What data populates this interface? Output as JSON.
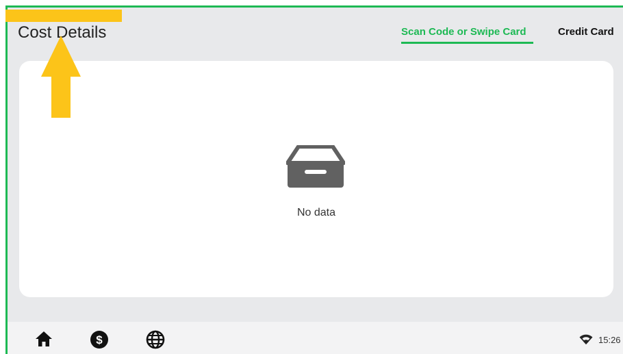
{
  "header": {
    "title": "Cost Details",
    "tabs": [
      {
        "label": "Scan Code or Swipe Card",
        "active": true
      },
      {
        "label": "Credit Card",
        "active": false
      }
    ]
  },
  "content": {
    "empty_text": "No data",
    "empty_icon": "inbox-icon"
  },
  "bottom_nav": {
    "icons": [
      "home-icon",
      "dollar-icon",
      "globe-icon"
    ]
  },
  "status_bar": {
    "time": "15:26",
    "wifi_icon": "wifi-icon"
  },
  "colors": {
    "accent": "#1db954",
    "highlight": "#fcc419",
    "background": "#e8e9eb"
  }
}
